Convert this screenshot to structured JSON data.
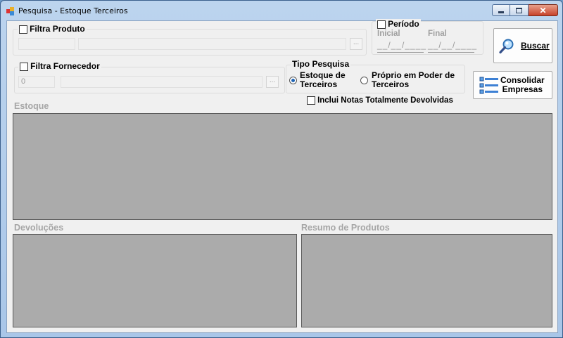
{
  "window": {
    "title": "Pesquisa - Estoque Terceiros"
  },
  "filtra_produto": {
    "label": "Filtra Produto",
    "checked": false,
    "lookup_label": "..."
  },
  "periodo": {
    "label": "Período",
    "checked": false,
    "inicial_label": "Inicial",
    "final_label": "Final",
    "inicial_value": "__/__/____",
    "final_value": "__/__/____"
  },
  "buscar": {
    "label": "Buscar",
    "icon": "magnifier-icon"
  },
  "filtra_fornecedor": {
    "label": "Filtra Fornecedor",
    "checked": false,
    "code_value": "0",
    "lookup_label": "..."
  },
  "tipo_pesquisa": {
    "label": "Tipo Pesquisa",
    "option1_line1": "Estoque de",
    "option1_line2": "Terceiros",
    "option2_line1": "Próprio em Poder de",
    "option2_line2": "Terceiros",
    "selected": "Estoque de Terceiros"
  },
  "consolidar": {
    "line1": "Consolidar",
    "line2": "Empresas",
    "icon": "list-icon"
  },
  "inclui_notas": {
    "label": "Inclui Notas Totalmente Devolvidas",
    "checked": false
  },
  "sections": {
    "estoque": "Estoque",
    "devolucoes": "Devoluções",
    "resumo": "Resumo de Produtos"
  },
  "colors": {
    "grid_bg": "#ababab",
    "radio_accent": "#1e64b4",
    "title_bar": "#bcd4ee"
  }
}
